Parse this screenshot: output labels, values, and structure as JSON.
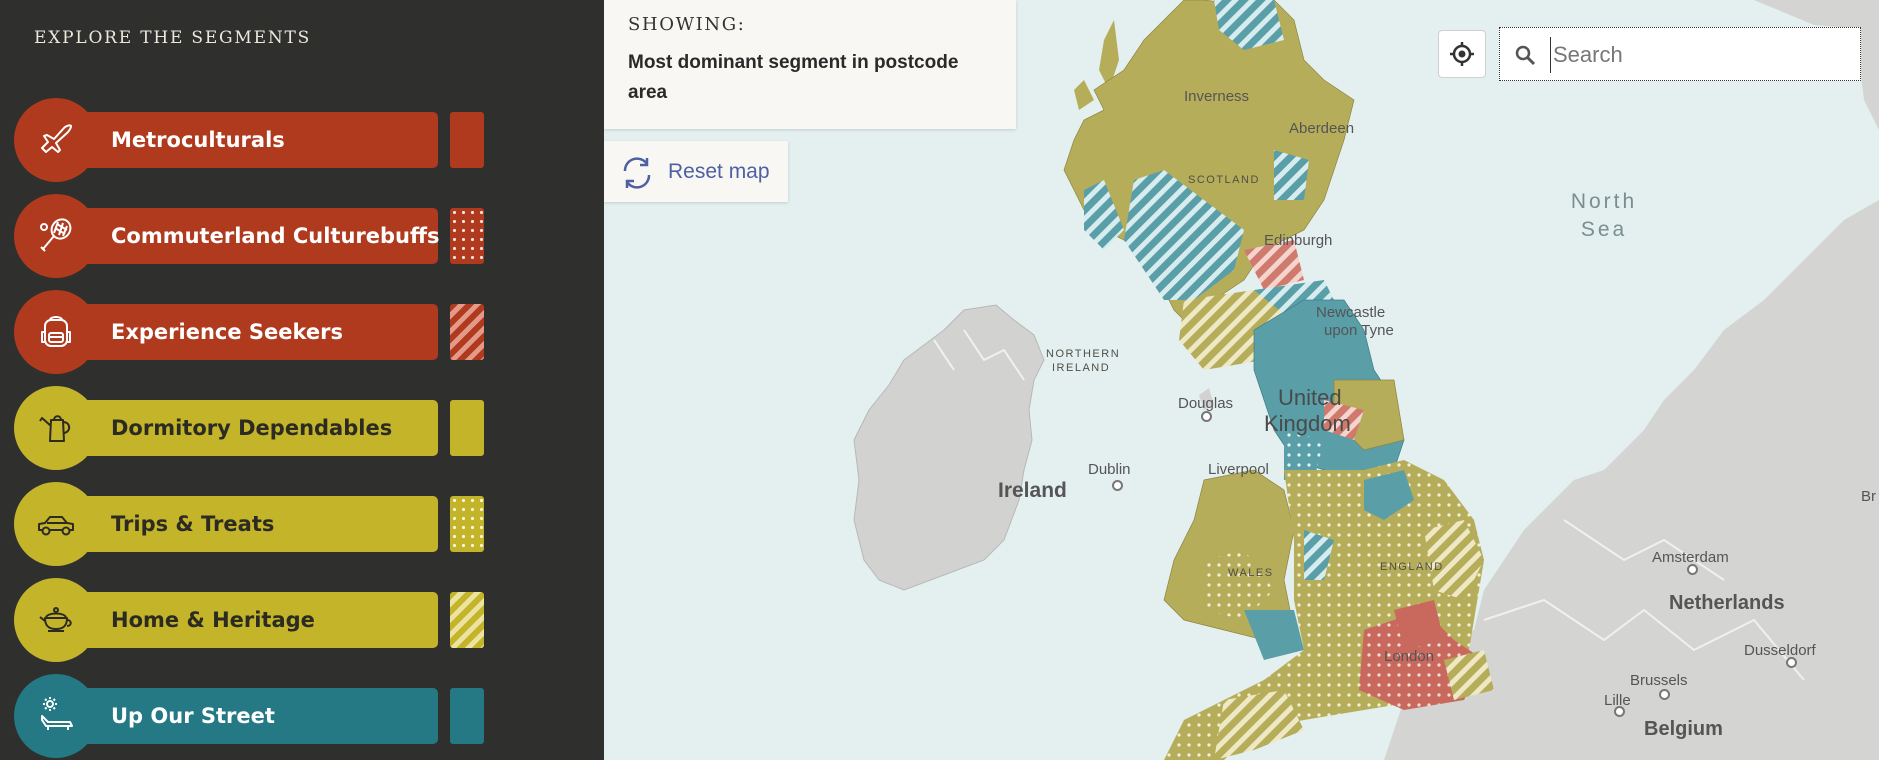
{
  "sidebar": {
    "title": "EXPLORE THE SEGMENTS",
    "segments": [
      {
        "label": "Metroculturals",
        "icon": "airplane-icon",
        "color": "#b03a1e",
        "swatch": "solid"
      },
      {
        "label": "Commuterland Culturebuffs",
        "icon": "tennis-racket-icon",
        "color": "#b03a1e",
        "swatch": "dots"
      },
      {
        "label": "Experience Seekers",
        "icon": "backpack-icon",
        "color": "#b03a1e",
        "swatch": "hatch"
      },
      {
        "label": "Dormitory Dependables",
        "icon": "watering-can-icon",
        "color": "#c3b42a",
        "swatch": "solid"
      },
      {
        "label": "Trips & Treats",
        "icon": "car-icon",
        "color": "#c3b42a",
        "swatch": "dots"
      },
      {
        "label": "Home & Heritage",
        "icon": "teapot-icon",
        "color": "#c3b42a",
        "swatch": "hatch"
      },
      {
        "label": "Up Our Street",
        "icon": "sun-lounger-icon",
        "color": "#247985",
        "swatch": "solid"
      }
    ]
  },
  "map": {
    "showing_label": "SHOWING:",
    "showing_value": "Most dominant segment in postcode area",
    "reset_label": "Reset map",
    "search_placeholder": "Search",
    "places": {
      "inverness": "Inverness",
      "aberdeen": "Aberdeen",
      "scotland": "SCOTLAND",
      "edinburgh": "Edinburgh",
      "newcastle_1": "Newcastle",
      "newcastle_2": "upon Tyne",
      "northern_ireland_1": "NORTHERN",
      "northern_ireland_2": "IRELAND",
      "douglas": "Douglas",
      "united_kingdom_1": "United",
      "united_kingdom_2": "Kingdom",
      "ireland": "Ireland",
      "dublin": "Dublin",
      "liverpool": "Liverpool",
      "wales": "WALES",
      "england": "ENGLAND",
      "london": "London",
      "north_sea_1": "North",
      "north_sea_2": "Sea",
      "amsterdam": "Amsterdam",
      "netherlands": "Netherlands",
      "dusseldorf": "Dusseldorf",
      "brussels": "Brussels",
      "lille": "Lille",
      "belgium": "Belgium",
      "br": "Br"
    }
  }
}
